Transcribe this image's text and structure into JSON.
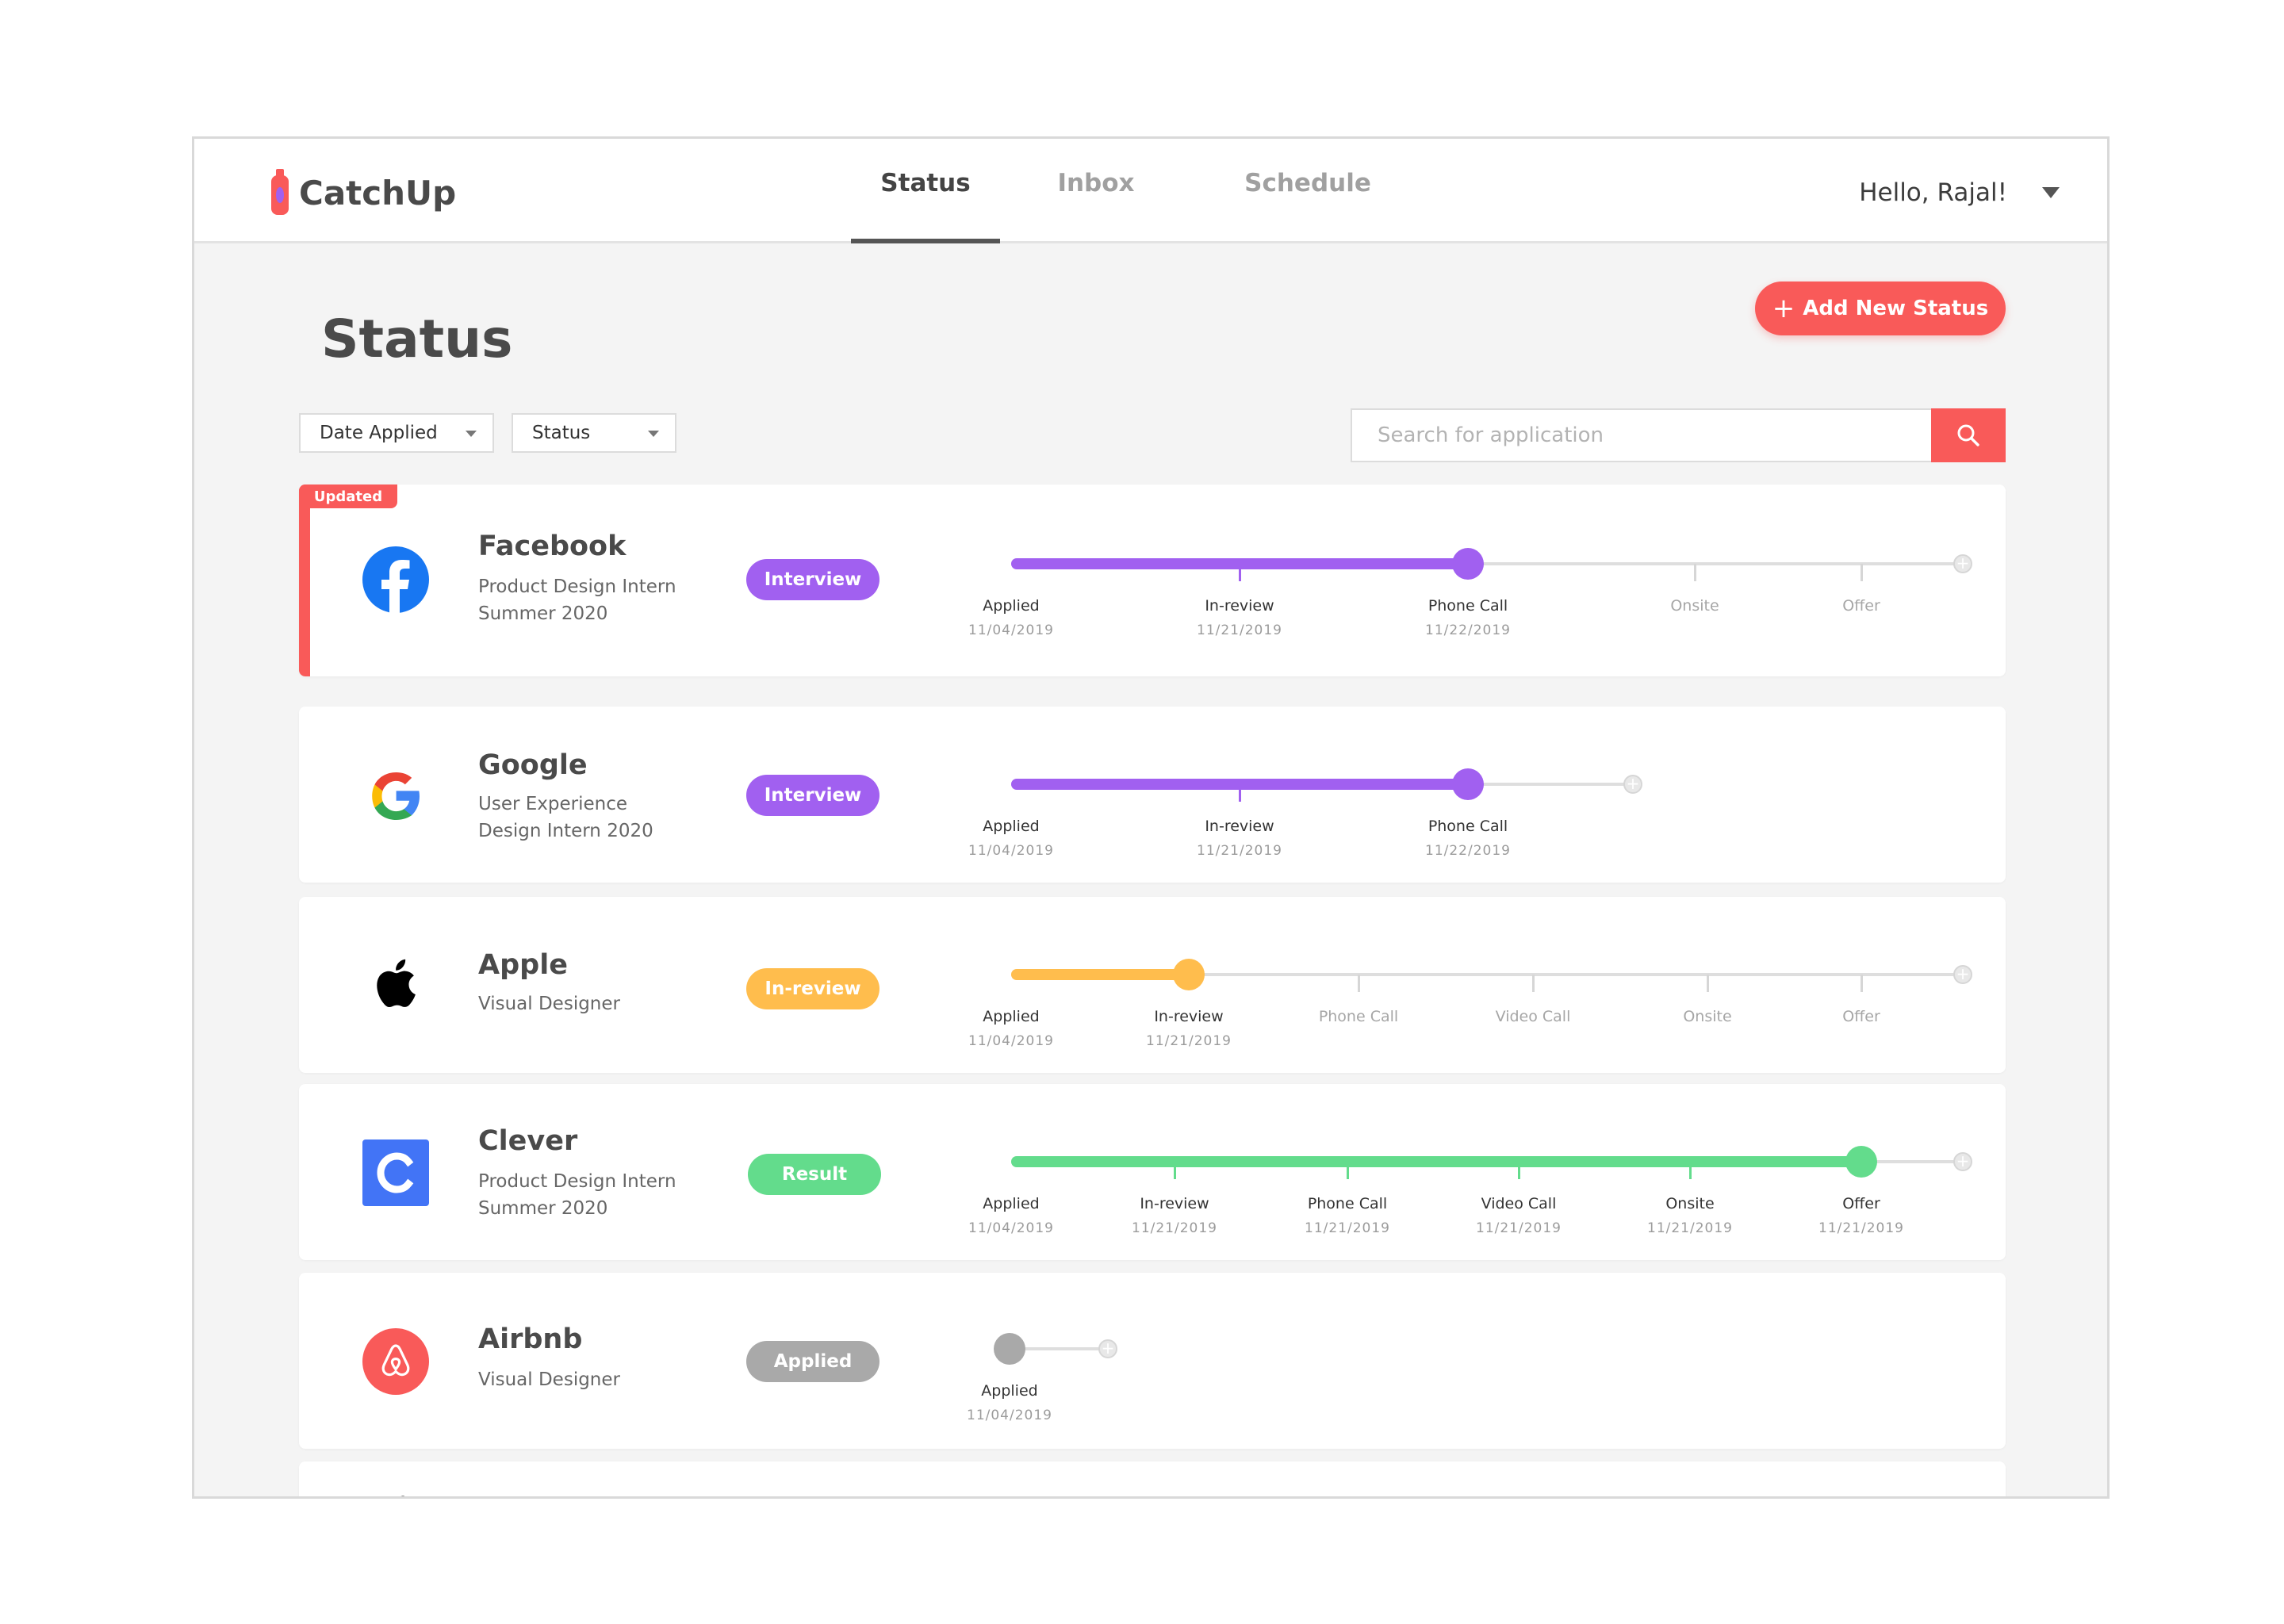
{
  "app": {
    "name": "CatchUp"
  },
  "nav": {
    "tabs": [
      {
        "label": "Status"
      },
      {
        "label": "Inbox"
      },
      {
        "label": "Schedule"
      }
    ],
    "greeting": "Hello, Rajal!"
  },
  "page": {
    "title": "Status",
    "add_button": "Add New Status"
  },
  "filters": {
    "date": "Date Applied",
    "status": "Status"
  },
  "search": {
    "placeholder": "Search for application"
  },
  "colors": {
    "accent": "#f95a59",
    "interview": "#a160f0",
    "inreview": "#ffbd4d",
    "result": "#63dc8c",
    "applied": "#a9a9a9"
  },
  "applications": [
    {
      "company": "Facebook",
      "role_line1": "Product Design Intern",
      "role_line2": "Summer 2020",
      "status": "Interview",
      "badge": "Updated",
      "logo": "facebook-icon",
      "stages": [
        {
          "name": "Applied",
          "date": "11/04/2019"
        },
        {
          "name": "In-review",
          "date": "11/21/2019"
        },
        {
          "name": "Phone Call",
          "date": "11/22/2019"
        },
        {
          "name": "Onsite"
        },
        {
          "name": "Offer"
        }
      ]
    },
    {
      "company": "Google",
      "role_line1": "User Experience",
      "role_line2": "Design Intern 2020",
      "status": "Interview",
      "logo": "google-icon",
      "stages": [
        {
          "name": "Applied",
          "date": "11/04/2019"
        },
        {
          "name": "In-review",
          "date": "11/21/2019"
        },
        {
          "name": "Phone Call",
          "date": "11/22/2019"
        }
      ]
    },
    {
      "company": "Apple",
      "role_line1": "Visual Designer",
      "role_line2": "",
      "status": "In-review",
      "logo": "apple-icon",
      "stages": [
        {
          "name": "Applied",
          "date": "11/04/2019"
        },
        {
          "name": "In-review",
          "date": "11/21/2019"
        },
        {
          "name": "Phone Call"
        },
        {
          "name": "Video Call"
        },
        {
          "name": "Onsite"
        },
        {
          "name": "Offer"
        }
      ]
    },
    {
      "company": "Clever",
      "role_line1": "Product Design Intern",
      "role_line2": "Summer 2020",
      "status": "Result",
      "logo": "clever-icon",
      "stages": [
        {
          "name": "Applied",
          "date": "11/04/2019"
        },
        {
          "name": "In-review",
          "date": "11/21/2019"
        },
        {
          "name": "Phone Call",
          "date": "11/21/2019"
        },
        {
          "name": "Video Call",
          "date": "11/21/2019"
        },
        {
          "name": "Onsite",
          "date": "11/21/2019"
        },
        {
          "name": "Offer",
          "date": "11/21/2019"
        }
      ]
    },
    {
      "company": "Airbnb",
      "role_line1": "Visual Designer",
      "role_line2": "",
      "status": "Applied",
      "logo": "airbnb-icon",
      "stages": [
        {
          "name": "Applied",
          "date": "11/04/2019"
        }
      ]
    }
  ]
}
